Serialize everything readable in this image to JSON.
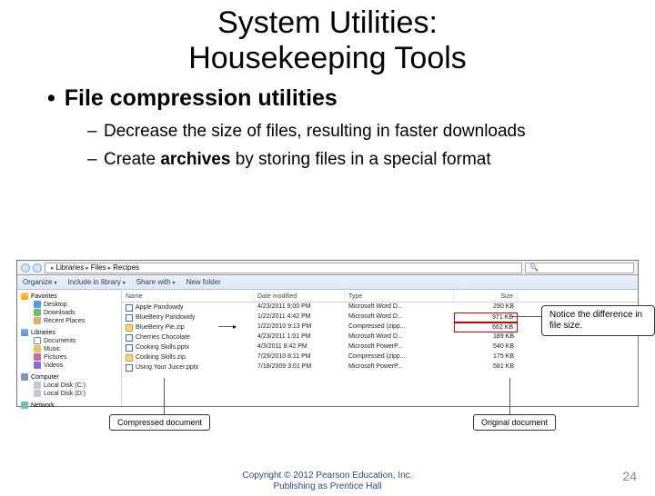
{
  "title_line1": "System Utilities:",
  "title_line2": "Housekeeping Tools",
  "bullet_main": "File compression utilities",
  "sub1": "Decrease the size of files, resulting in faster downloads",
  "sub2_pre": "Create ",
  "sub2_strong": "archives",
  "sub2_post": " by storing files in a special format",
  "path": {
    "seg1": "Libraries",
    "seg2": "Files",
    "seg3": "Recipes"
  },
  "toolbar": {
    "organize": "Organize",
    "include": "Include in library",
    "share": "Share with",
    "newfolder": "New folder"
  },
  "sidebar": {
    "fav": "Favorites",
    "desktop": "Desktop",
    "downloads": "Downloads",
    "recent": "Recent Places",
    "lib": "Libraries",
    "docs": "Documents",
    "music": "Music",
    "pics": "Pictures",
    "vids": "Videos",
    "comp": "Computer",
    "drive1": "Local Disk (C:)",
    "drive2": "Local Disk (D:)",
    "net": "Network"
  },
  "columns": {
    "name": "Name",
    "date": "Date modified",
    "type": "Type",
    "size": "Size"
  },
  "files": [
    {
      "name": "Apple Pandowdy",
      "date": "4/23/2011 9:00 PM",
      "type": "Microsoft Word D...",
      "size": "290 KB",
      "icon": "f-doc",
      "hlsize": false
    },
    {
      "name": "BlueBerry Pandowdy",
      "date": "1/22/2011 4:42 PM",
      "type": "Microsoft Word D...",
      "size": "971 KB",
      "icon": "f-doc",
      "hlsize": true
    },
    {
      "name": "BlueBerry Pie.zip",
      "date": "1/22/2010 9:13 PM",
      "type": "Compressed (zipp...",
      "size": "662 KB",
      "icon": "f-zip",
      "hlsize": true,
      "arrow": true
    },
    {
      "name": "Cherries Chocolate",
      "date": "4/23/2011 1:01 PM",
      "type": "Microsoft Word D...",
      "size": "189 KB",
      "icon": "f-doc",
      "hlsize": false
    },
    {
      "name": "Cooking Skills.pptx",
      "date": "4/3/2011 8:42 PM",
      "type": "Microsoft PowerP...",
      "size": "540 KB",
      "icon": "f-doc",
      "hlsize": false
    },
    {
      "name": "Cooking Skills.zip",
      "date": "7/29/2010 8:11 PM",
      "type": "Compressed (zipp...",
      "size": "175 KB",
      "icon": "f-zip",
      "hlsize": false
    },
    {
      "name": "Using Your Juicer.pptx",
      "date": "7/18/2009 3:01 PM",
      "type": "Microsoft PowerP...",
      "size": "581 KB",
      "icon": "f-doc",
      "hlsize": false
    }
  ],
  "callout_diff": "Notice the difference in file size.",
  "label_compressed": "Compressed document",
  "label_original": "Original document",
  "copyright_l1": "Copyright © 2012 Pearson Education, Inc.",
  "copyright_l2": "Publishing as Prentice Hall",
  "slidenum": "24"
}
